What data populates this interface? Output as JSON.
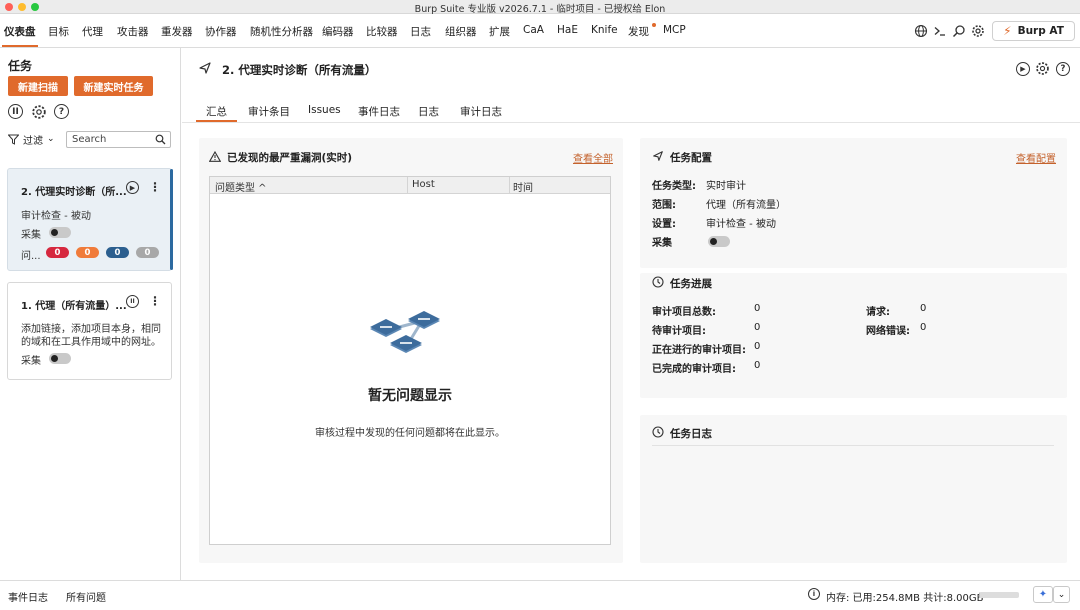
{
  "window": {
    "title": "Burp Suite 专业版  v2026.7.1 - 临时项目 - 已授权给 Elon"
  },
  "menu": {
    "items": [
      "仪表盘",
      "目标",
      "代理",
      "攻击器",
      "重发器",
      "协作器",
      "随机性分析器",
      "编码器",
      "比较器",
      "日志",
      "组织器",
      "扩展",
      "CaA",
      "HaE",
      "Knife",
      "发现",
      "MCP"
    ],
    "active": "仪表盘",
    "burp_at_label": "Burp AT",
    "accent_color": "#e06a2c"
  },
  "left": {
    "title": "任务",
    "new_scan_label": "新建扫描",
    "new_live_task_label": "新建实时任务",
    "filter_label": "过滤",
    "search_placeholder": "Search",
    "tasks": [
      {
        "title": "2. 代理实时诊断（所...",
        "description": "审计检查 - 被动",
        "capture_label": "采集",
        "issues_label": "问...",
        "issue_counts": [
          "0",
          "0",
          "0",
          "0"
        ],
        "issue_colors": [
          "#d6283f",
          "#f07b3a",
          "#2c5f8f",
          "#a8a8a8"
        ]
      },
      {
        "title": "1. 代理（所有流量）...",
        "description_line1": "添加链接，添加项目本身，相同",
        "description_line2": "的域和在工具作用域中的网址。",
        "capture_label": "采集"
      }
    ]
  },
  "main": {
    "title": "2. 代理实时诊断（所有流量）",
    "tabs": [
      "汇总",
      "审计条目",
      "Issues",
      "事件日志",
      "日志",
      "审计日志"
    ],
    "active_tab": "汇总",
    "issues_panel": {
      "title": "已发现的最严重漏洞(实时)",
      "view_all": "查看全部",
      "columns": [
        "问题类型 ^",
        "Host",
        "时间"
      ],
      "empty_title": "暂无问题显示",
      "empty_subtitle": "审核过程中发现的任何问题都将在此显示。"
    },
    "config_panel": {
      "title": "任务配置",
      "view_link": "查看配置",
      "rows": [
        {
          "key": "任务类型:",
          "value": "实时审计"
        },
        {
          "key": "范围:",
          "value": "代理（所有流量）"
        },
        {
          "key": "设置:",
          "value": "审计检查 - 被动"
        },
        {
          "key": "采集",
          "value": ""
        }
      ]
    },
    "progress_panel": {
      "title": "任务进展",
      "left_rows": [
        {
          "key": "审计项目总数:",
          "value": "0"
        },
        {
          "key": "待审计项目:",
          "value": "0"
        },
        {
          "key": "正在进行的审计项目:",
          "value": "0"
        },
        {
          "key": "已完成的审计项目:",
          "value": "0"
        }
      ],
      "right_rows": [
        {
          "key": "请求:",
          "value": "0"
        },
        {
          "key": "网络错误:",
          "value": "0"
        }
      ]
    },
    "log_panel": {
      "title": "任务日志"
    }
  },
  "status": {
    "event_log": "事件日志",
    "all_issues": "所有问题",
    "memory": "内存: 已用:254.8MB 共计:8.00GB",
    "memory_used_fraction": 0.03
  }
}
